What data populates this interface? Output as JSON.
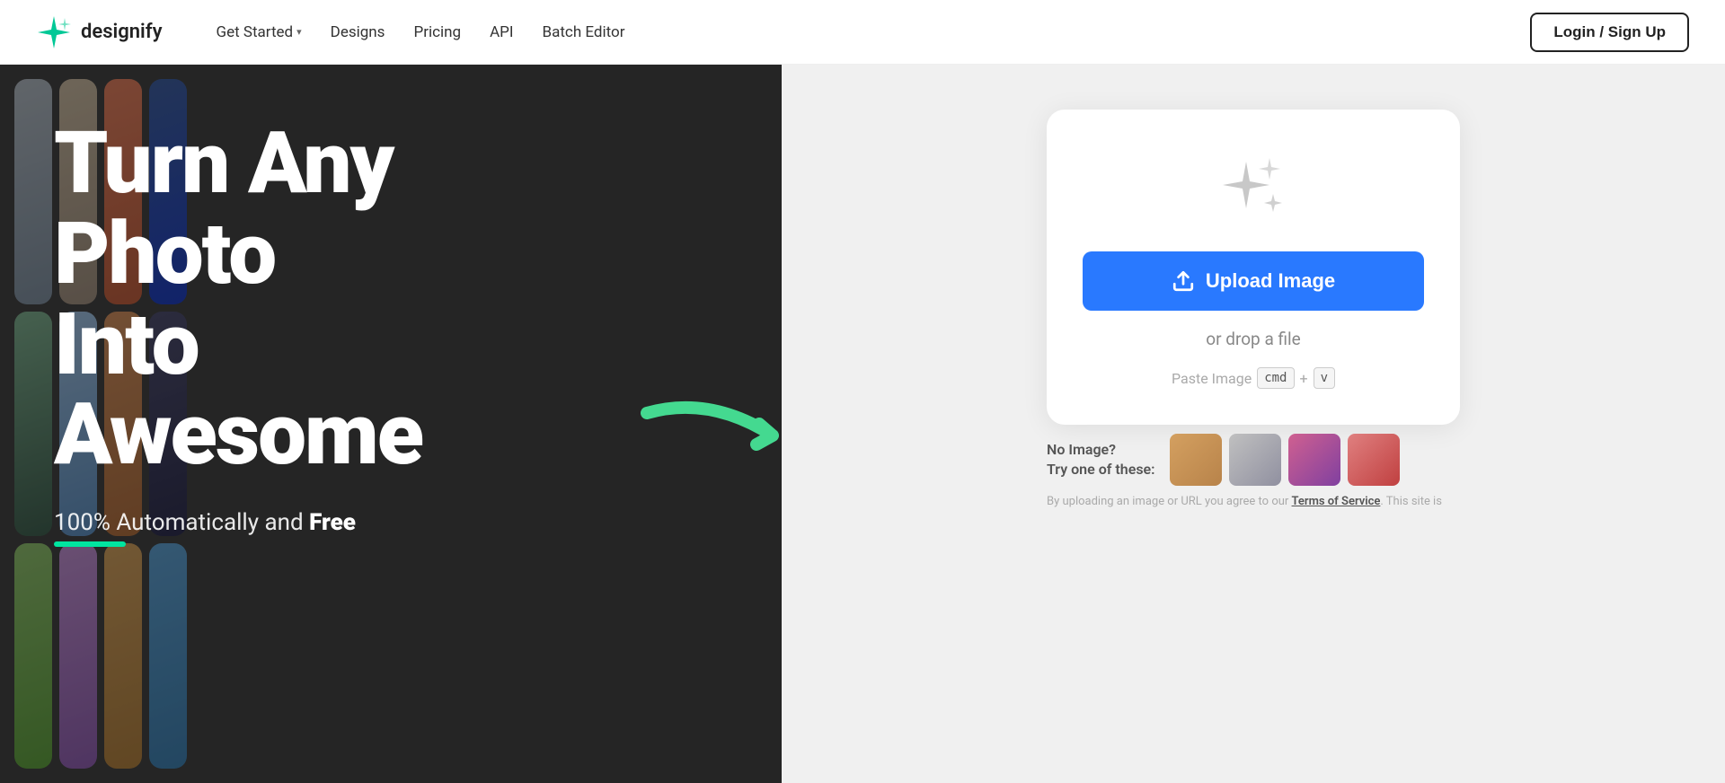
{
  "navbar": {
    "logo_text": "designify",
    "nav_items": [
      {
        "label": "Get Started",
        "dropdown": true
      },
      {
        "label": "Designs",
        "dropdown": false
      },
      {
        "label": "Pricing",
        "dropdown": false
      },
      {
        "label": "API",
        "dropdown": false
      },
      {
        "label": "Batch Editor",
        "dropdown": false
      }
    ],
    "login_label": "Login / Sign Up"
  },
  "hero": {
    "title_line1": "Turn Any",
    "title_line2": "Photo",
    "title_line3": "Into",
    "title_line4": "Awesome",
    "subtitle_text": "100% Automatically and ",
    "subtitle_bold": "Free"
  },
  "upload_card": {
    "upload_btn_label": "Upload Image",
    "drop_text": "or drop a file",
    "paste_label": "Paste Image",
    "paste_key1": "cmd",
    "paste_plus": "+",
    "paste_key2": "v"
  },
  "no_image": {
    "line1": "No Image?",
    "line2": "Try one of these:"
  },
  "terms": {
    "text": "By uploading an image or URL you agree to our ",
    "link": "Terms of Service",
    "suffix": ". This site is"
  }
}
